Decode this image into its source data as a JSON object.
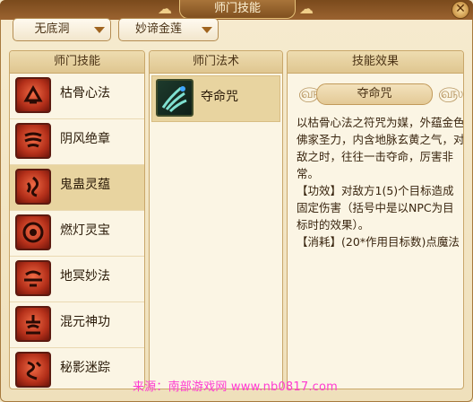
{
  "window": {
    "title": "师门技能",
    "close_icon": "✕"
  },
  "dropdowns": {
    "location": "无底洞",
    "faction": "妙谛金莲"
  },
  "skills_panel": {
    "header": "师门技能",
    "items": [
      {
        "label": "枯骨心法",
        "icon": "skull-bones-icon"
      },
      {
        "label": "阴风绝章",
        "icon": "wind-scroll-icon"
      },
      {
        "label": "鬼蛊灵蕴",
        "icon": "ghost-gu-icon",
        "selected": true
      },
      {
        "label": "燃灯灵宝",
        "icon": "lamp-treasure-icon"
      },
      {
        "label": "地冥妙法",
        "icon": "underworld-icon"
      },
      {
        "label": "混元神功",
        "icon": "chaos-power-icon"
      },
      {
        "label": "秘影迷踪",
        "icon": "shadow-trace-icon"
      }
    ]
  },
  "spells_panel": {
    "header": "师门法术",
    "items": [
      {
        "label": "夺命咒",
        "icon": "claw-spell-icon",
        "selected": true
      }
    ]
  },
  "effect_panel": {
    "header": "技能效果",
    "spell_name": "夺命咒",
    "description": "以枯骨心法之符咒为媒，外蕴金色佛家圣力，内含地脉玄黄之气，对敌之时，往往一击夺命，厉害非常。",
    "effect_line": "【功效】对敌方1(5)个目标造成固定伤害（括号中是以NPC为目标时的效果）。",
    "cost_line": "【消耗】(20*作用目标数)点魔法"
  },
  "watermark": "来源：南部游戏网 www.nb0817.com",
  "colors": {
    "accent": "#9b6330",
    "selected_row": "#e8d4a0",
    "icon_red": "#c2381f"
  }
}
